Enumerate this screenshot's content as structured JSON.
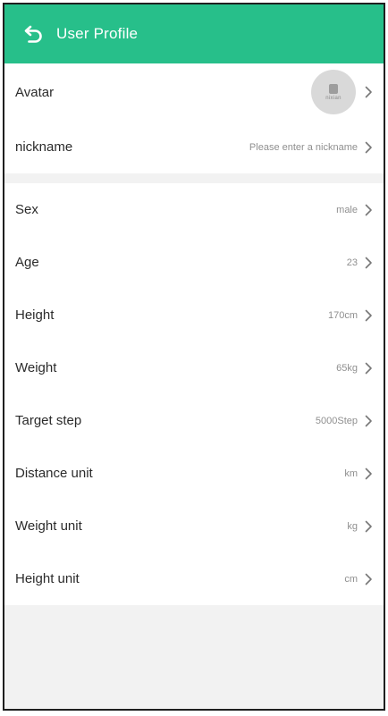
{
  "header": {
    "title": "User Profile",
    "back_icon": "back-arrow-icon",
    "background_color": "#27bf8a"
  },
  "account": {
    "avatar_label": "Avatar",
    "avatar_caption": "nixian",
    "nickname_label": "nickname",
    "nickname_placeholder": "Please enter a nickname"
  },
  "fields": [
    {
      "label": "Sex",
      "value": "male"
    },
    {
      "label": "Age",
      "value": "23"
    },
    {
      "label": "Height",
      "value": "170cm"
    },
    {
      "label": "Weight",
      "value": "65kg"
    },
    {
      "label": "Target step",
      "value": "5000Step"
    },
    {
      "label": "Distance unit",
      "value": "km"
    },
    {
      "label": "Weight unit",
      "value": "kg"
    },
    {
      "label": "Height unit",
      "value": "cm"
    }
  ],
  "icons": {
    "row_arrow": "chevron-right-icon"
  }
}
